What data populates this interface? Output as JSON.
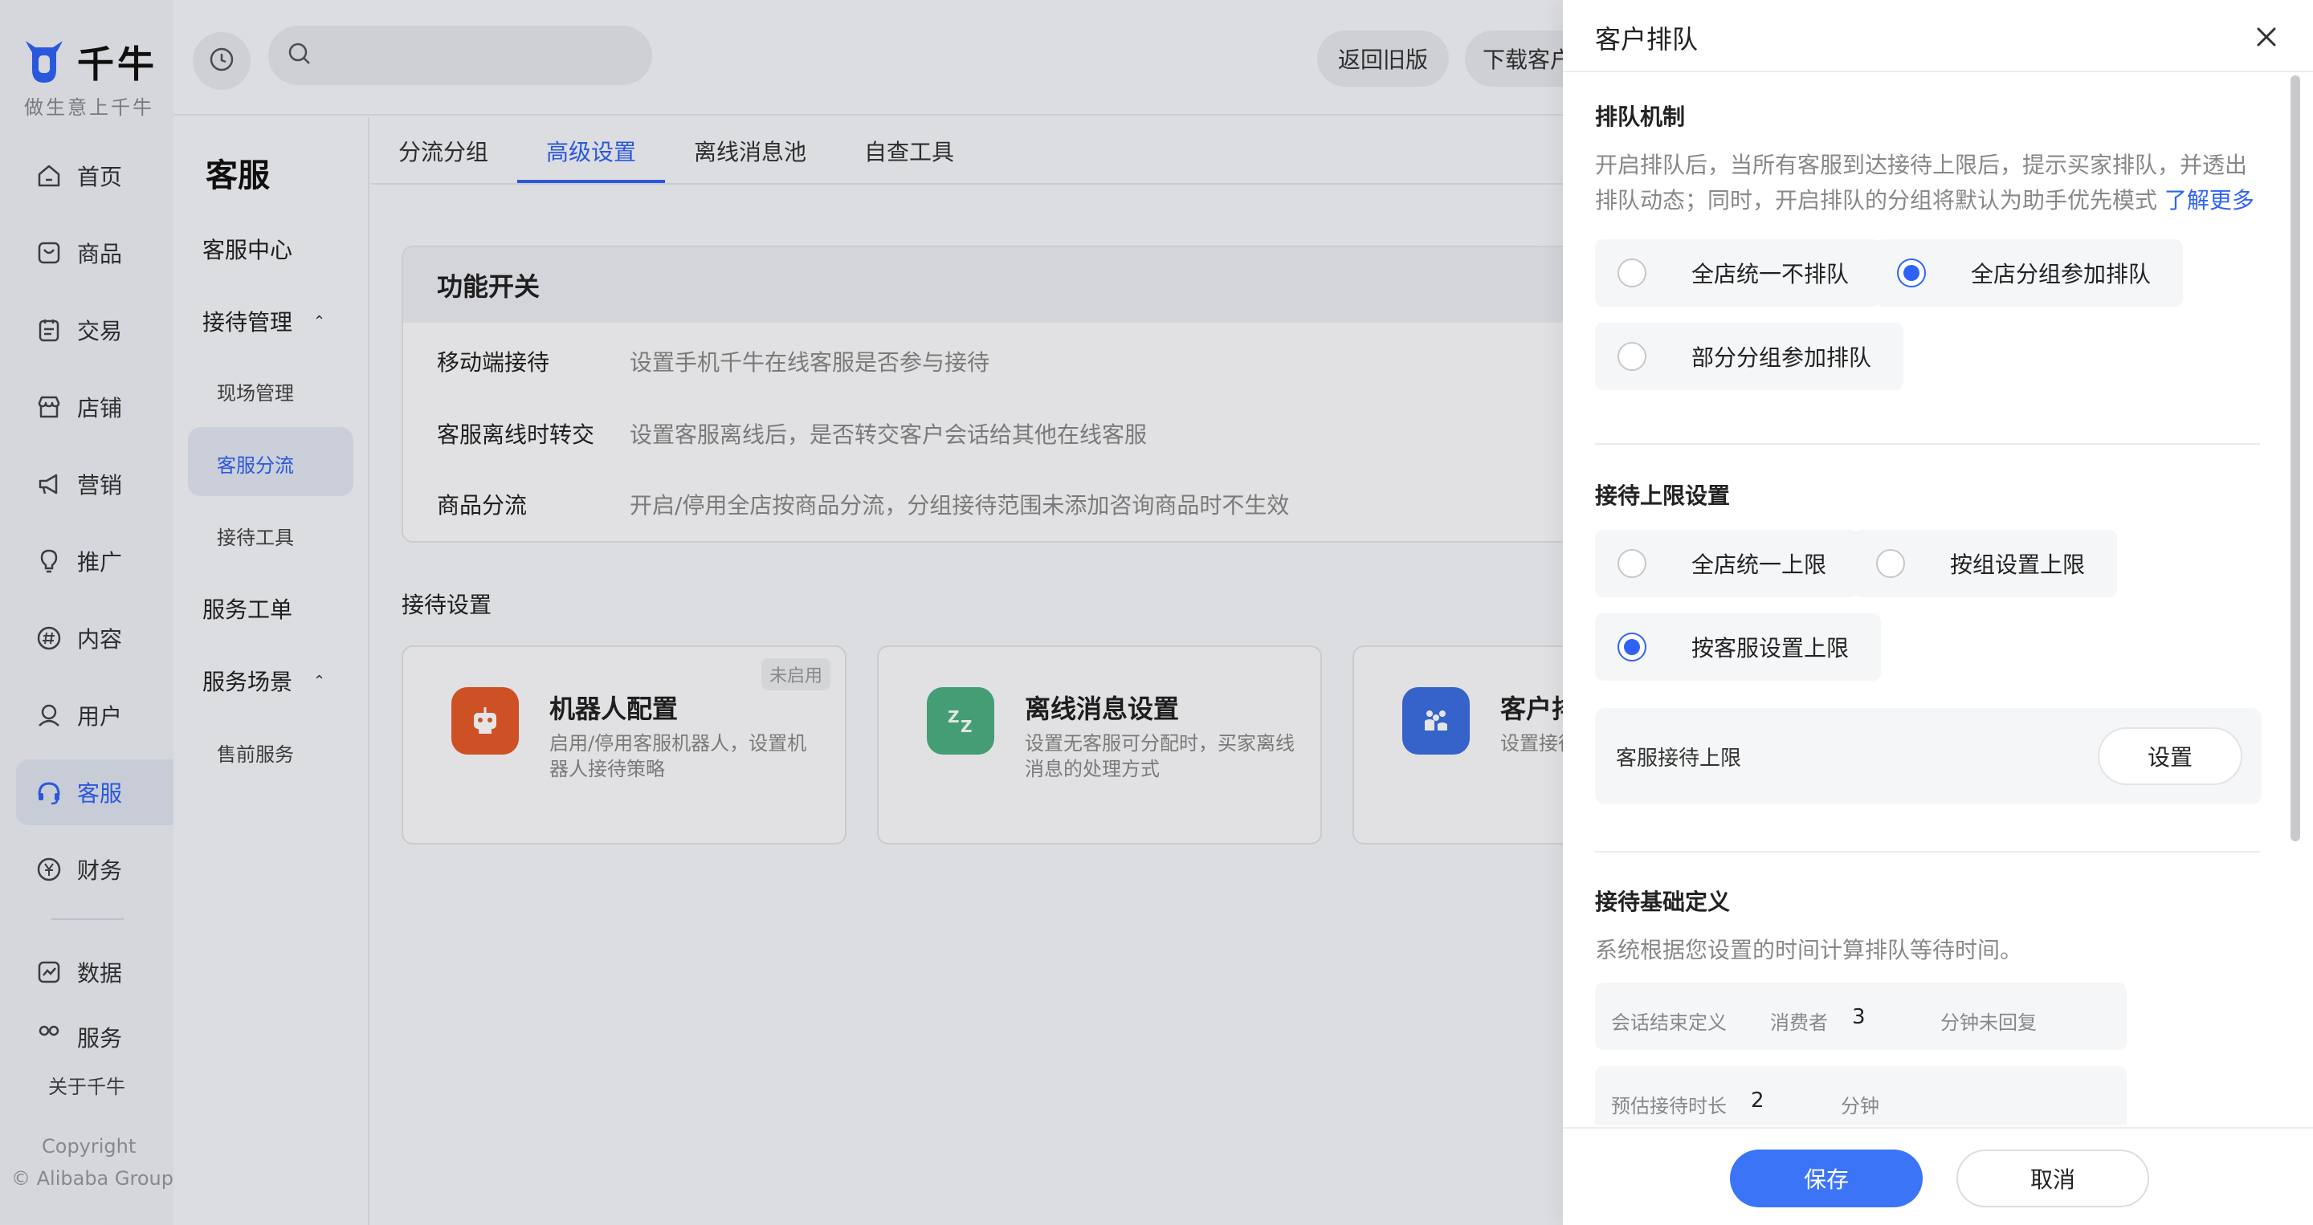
{
  "brand": {
    "name": "千牛",
    "slogan": "做生意上千牛",
    "color": "#2f63f5"
  },
  "leftnav": {
    "items": [
      {
        "label": "首页",
        "icon": "home-icon"
      },
      {
        "label": "商品",
        "icon": "goods-icon"
      },
      {
        "label": "交易",
        "icon": "trade-icon"
      },
      {
        "label": "店铺",
        "icon": "store-icon"
      },
      {
        "label": "营销",
        "icon": "megaphone-icon"
      },
      {
        "label": "推广",
        "icon": "bulb-icon"
      },
      {
        "label": "内容",
        "icon": "hashtag-icon"
      },
      {
        "label": "用户",
        "icon": "user-icon"
      },
      {
        "label": "客服",
        "icon": "headset-icon",
        "active": true
      },
      {
        "label": "财务",
        "icon": "yen-icon"
      }
    ],
    "bottom_items": [
      {
        "label": "数据",
        "icon": "chart-icon"
      },
      {
        "label": "服务",
        "icon": "service-icon"
      }
    ],
    "about": "关于千牛",
    "copyright_1": "Copyright",
    "copyright_2": "© Alibaba Group"
  },
  "topbar": {
    "search_placeholder": "",
    "return_old": "返回旧版",
    "download": "下载客户端"
  },
  "subnav": {
    "title": "客服",
    "center": "客服中心",
    "reception_mgmt": "接待管理",
    "onsite_mgmt": "现场管理",
    "cs_routing": "客服分流",
    "reception_tools": "接待工具",
    "service_ticket": "服务工单",
    "service_scene": "服务场景",
    "presale": "售前服务"
  },
  "tabs": [
    "分流分组",
    "高级设置",
    "离线消息池",
    "自查工具"
  ],
  "func": {
    "title": "功能开关",
    "rows": [
      {
        "name": "移动端接待",
        "desc": "设置手机千牛在线客服是否参与接待"
      },
      {
        "name": "客服离线时转交",
        "desc": "设置客服离线后，是否转交客户会话给其他在线客服"
      },
      {
        "name": "商品分流",
        "desc": "开启/停用全店按商品分流，分组接待范围未添加咨询商品时不生效"
      }
    ]
  },
  "reception": {
    "title": "接待设置",
    "cards": [
      {
        "name": "机器人配置",
        "desc": "启用/停用客服机器人，设置机器人接待策略",
        "badge": "未启用",
        "color": "#e65a2a"
      },
      {
        "name": "离线消息设置",
        "desc": "设置无客服可分配时，买家离线消息的处理方式",
        "color": "#4caf82"
      },
      {
        "name": "客户排队",
        "desc": "设置接待上限与排队等待",
        "color": "#3b6fe0"
      }
    ]
  },
  "drawer": {
    "title": "客户排队",
    "queue": {
      "title": "排队机制",
      "desc": "开启排队后，当所有客服到达接待上限后，提示买家排队，并透出排队动态；同时，开启排队的分组将默认为助手优先模式",
      "learn_more": "了解更多",
      "options": [
        "全店统一不排队",
        "全店分组参加排队",
        "部分分组参加排队"
      ],
      "selected": "全店分组参加排队"
    },
    "limit": {
      "title": "接待上限设置",
      "options": [
        "全店统一上限",
        "按组设置上限",
        "按客服设置上限"
      ],
      "selected": "按客服设置上限",
      "box_label": "客服接待上限",
      "box_button": "设置"
    },
    "basic": {
      "title": "接待基础定义",
      "desc": "系统根据您设置的时间计算排队等待时间。",
      "row1": {
        "label": "会话结束定义",
        "who": "消费者",
        "value": "3",
        "unit": "分钟未回复"
      },
      "row2": {
        "label": "预估接待时长",
        "value": "2",
        "unit": "分钟"
      }
    },
    "save": "保存",
    "cancel": "取消"
  }
}
